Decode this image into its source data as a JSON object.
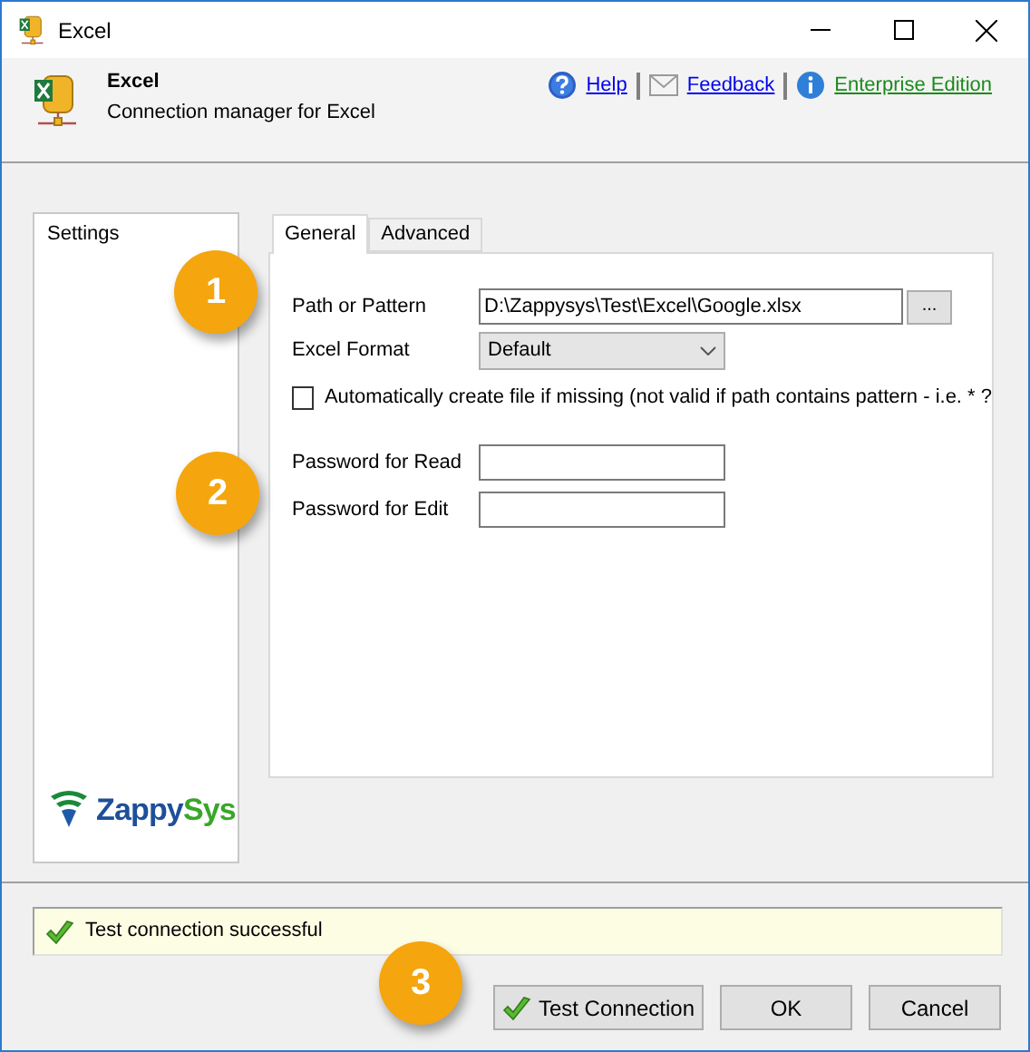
{
  "window": {
    "title": "Excel"
  },
  "header": {
    "title": "Excel",
    "subtitle": "Connection manager for Excel",
    "links": [
      {
        "kind": "help",
        "label": "Help"
      },
      {
        "kind": "feedback",
        "label": "Feedback"
      },
      {
        "kind": "edition",
        "label": "Enterprise Edition"
      }
    ]
  },
  "sidebar": {
    "items": [
      {
        "label": "Settings",
        "selected": true
      }
    ],
    "logo": {
      "part1": "Zappy",
      "part2": "Sys"
    }
  },
  "tabs": [
    {
      "label": "General",
      "selected": true
    },
    {
      "label": "Advanced",
      "selected": false
    }
  ],
  "form": {
    "path_label": "Path or Pattern",
    "path_value": "D:\\Zappysys\\Test\\Excel\\Google.xlsx",
    "browse_label": "...",
    "format_label": "Excel Format",
    "format_value": "Default",
    "auto_create": {
      "label": "Automatically create file if missing (not valid if path contains pattern - i.e. * ?",
      "checked": false
    },
    "password_read_label": "Password for Read",
    "password_edit_label": "Password for Edit"
  },
  "status": {
    "message": "Test connection successful",
    "success": true
  },
  "buttons": [
    {
      "kind": "test",
      "label": "Test Connection"
    },
    {
      "kind": "plain",
      "label": "OK"
    },
    {
      "kind": "plain",
      "label": "Cancel"
    }
  ],
  "callouts": [
    "1",
    "2",
    "3"
  ]
}
